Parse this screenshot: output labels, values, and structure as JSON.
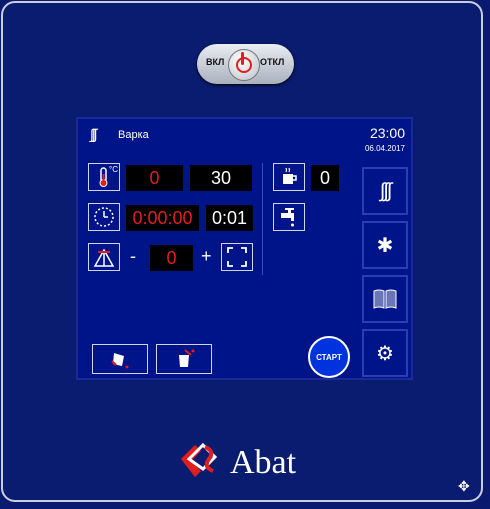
{
  "power": {
    "on_label": "ВКЛ",
    "off_label": "ОТКЛ"
  },
  "header": {
    "mode_icon": "steam-icon",
    "mode_label": "Варка",
    "time": "23:00",
    "date": "06.04.2017"
  },
  "temperature": {
    "icon": "thermometer-icon",
    "unit": "°C",
    "current": "0",
    "target": "30"
  },
  "timer": {
    "icon": "clock-icon",
    "elapsed": "0:00:00",
    "set": "0:01"
  },
  "fan": {
    "icon": "fan-speed-icon",
    "minus": "-",
    "value": "0",
    "plus": "+",
    "expand_icon": "fullscreen-icon"
  },
  "humidity": {
    "icon": "cup-icon",
    "value": "0",
    "tap_icon": "water-tap-icon"
  },
  "side_buttons": [
    {
      "icon": "steam-mode-icon"
    },
    {
      "icon": "snowflake-icon"
    },
    {
      "icon": "recipe-book-icon"
    },
    {
      "icon": "settings-gear-icon"
    }
  ],
  "start_label": "СТАРТ",
  "bottom_buttons": [
    {
      "icon": "drain-icon"
    },
    {
      "icon": "fill-icon"
    }
  ],
  "brand": {
    "name": "Abat"
  },
  "colors": {
    "panel": "#0a1c70",
    "screen": "#001489",
    "value_red": "#e21d1d",
    "start": "#0033dd"
  }
}
